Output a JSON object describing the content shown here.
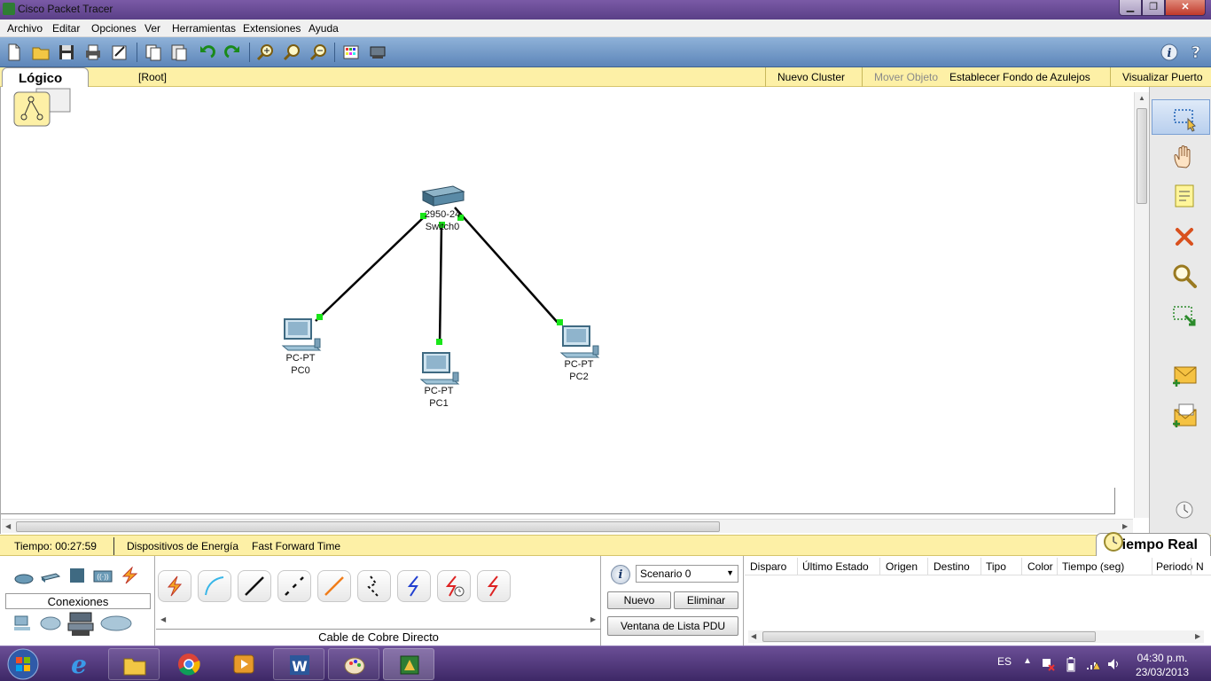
{
  "window": {
    "title": "Cisco Packet Tracer",
    "min_glyph": "▁",
    "max_glyph": "❐",
    "close_glyph": "✕"
  },
  "menu": [
    "Archivo",
    "Editar",
    "Opciones",
    "Ver",
    "Herramientas",
    "Extensiones",
    "Ayuda"
  ],
  "toolbar": {
    "icons": [
      "new-file-icon",
      "open-folder-icon",
      "save-icon",
      "print-icon",
      "activity-wizard-icon",
      "copy-icon",
      "paste-icon",
      "undo-icon",
      "redo-icon",
      "zoom-in-icon",
      "zoom-reset-icon",
      "zoom-out-icon",
      "palette-icon",
      "custom-device-icon"
    ],
    "info_glyph": "i",
    "help_glyph": "?"
  },
  "logical_bar": {
    "tab_label": "Lógico",
    "root_label": "[Root]",
    "actions": {
      "new_cluster": "Nuevo Cluster",
      "move_object": "Mover Objeto",
      "set_tiled_background": "Establecer Fondo de Azulejos",
      "viewport": "Visualizar Puerto"
    }
  },
  "network": {
    "switch": {
      "model": "2950-24",
      "name": "Switch0"
    },
    "pcs": [
      {
        "model": "PC-PT",
        "name": "PC0"
      },
      {
        "model": "PC-PT",
        "name": "PC1"
      },
      {
        "model": "PC-PT",
        "name": "PC2"
      }
    ],
    "link_color": "#000000",
    "port_light_color": "#19e619"
  },
  "right_tools": [
    "select-icon",
    "hand-move-icon",
    "note-icon",
    "delete-icon",
    "inspect-icon",
    "resize-shape-icon",
    "add-simple-pdu-icon",
    "add-complex-pdu-icon"
  ],
  "status_bar": {
    "time": "Tiempo: 00:27:59",
    "power_cycle": "Dispositivos de Energía",
    "fast_forward": "Fast Forward Time",
    "mode_tab": "Tiempo Real"
  },
  "device_panel": {
    "category_label": "Conexiones"
  },
  "cables": {
    "types": [
      "automatic-cable-icon",
      "console-cable-icon",
      "copper-straight-icon",
      "copper-cross-icon",
      "fiber-icon",
      "phone-cable-icon",
      "coaxial-icon",
      "serial-dce-icon",
      "serial-dte-icon"
    ],
    "selected_name": "Cable de Cobre Directo"
  },
  "scenario": {
    "info_glyph": "i",
    "selected": "Scenario 0",
    "new_button": "Nuevo",
    "delete_button": "Eliminar",
    "pdu_list_button": "Ventana de Lista PDU"
  },
  "pdu_table": {
    "columns": [
      "Disparo",
      "Último Estado",
      "Origen",
      "Destino",
      "Tipo",
      "Color",
      "Tiempo (seg)",
      "Periodo",
      "N"
    ]
  },
  "taskbar": {
    "language": "ES",
    "time": "04:30 p.m.",
    "date": "23/03/2013"
  },
  "colors": {
    "accent_yellow": "#fdf0a6",
    "toolbar_blue": "#6f96c6",
    "taskbar_purple": "#4f3780"
  }
}
